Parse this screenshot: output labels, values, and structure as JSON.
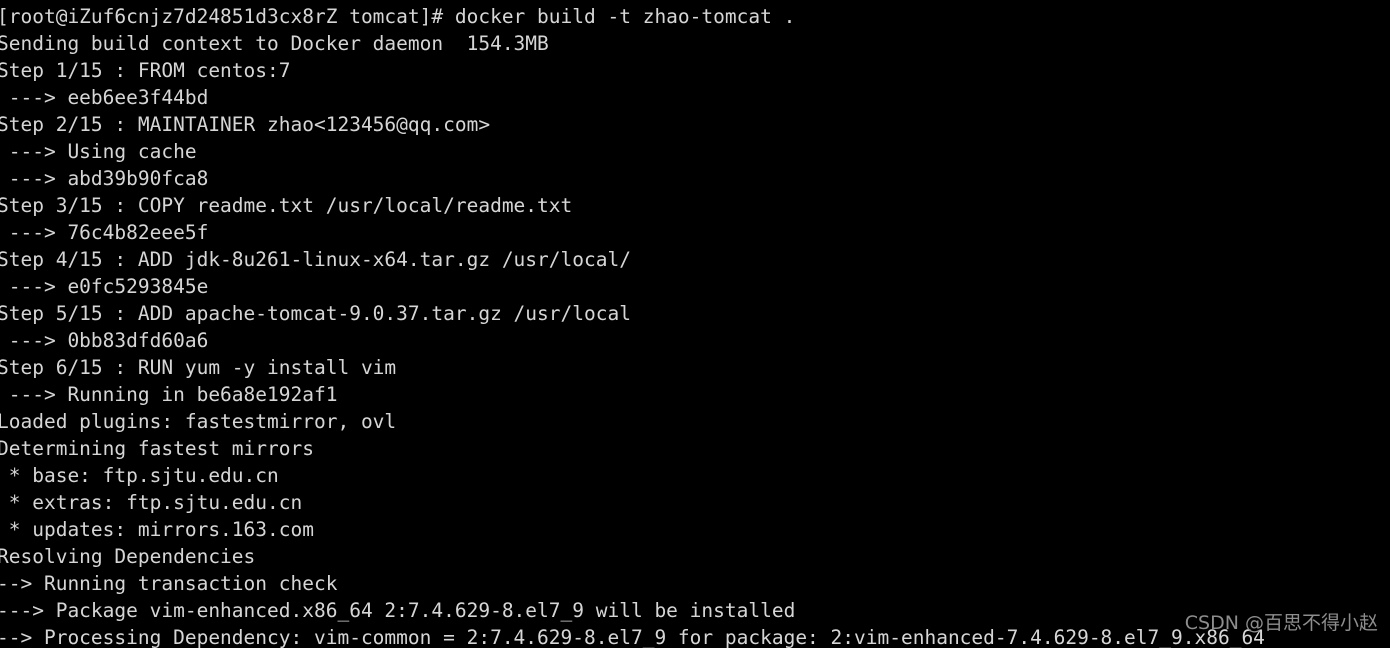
{
  "terminal": {
    "background_color": "#000000",
    "text_color": "#d6d6d6",
    "prompt": "[root@iZuf6cnjz7d24851d3cx8rZ tomcat]#",
    "command": "docker build -t zhao-tomcat .",
    "lines": [
      "[root@iZuf6cnjz7d24851d3cx8rZ tomcat]# docker build -t zhao-tomcat .",
      "Sending build context to Docker daemon  154.3MB",
      "Step 1/15 : FROM centos:7",
      " ---> eeb6ee3f44bd",
      "Step 2/15 : MAINTAINER zhao<123456@qq.com>",
      " ---> Using cache",
      " ---> abd39b90fca8",
      "Step 3/15 : COPY readme.txt /usr/local/readme.txt",
      " ---> 76c4b82eee5f",
      "Step 4/15 : ADD jdk-8u261-linux-x64.tar.gz /usr/local/",
      " ---> e0fc5293845e",
      "Step 5/15 : ADD apache-tomcat-9.0.37.tar.gz /usr/local",
      " ---> 0bb83dfd60a6",
      "Step 6/15 : RUN yum -y install vim",
      " ---> Running in be6a8e192af1",
      "Loaded plugins: fastestmirror, ovl",
      "Determining fastest mirrors",
      " * base: ftp.sjtu.edu.cn",
      " * extras: ftp.sjtu.edu.cn",
      " * updates: mirrors.163.com",
      "Resolving Dependencies",
      "--> Running transaction check",
      "---> Package vim-enhanced.x86_64 2:7.4.629-8.el7_9 will be installed",
      "--> Processing Dependency: vim-common = 2:7.4.629-8.el7_9 for package: 2:vim-enhanced-7.4.629-8.el7_9.x86_64"
    ]
  },
  "watermark": {
    "text": "CSDN @百思不得小赵",
    "color": "#8d8d8d"
  }
}
